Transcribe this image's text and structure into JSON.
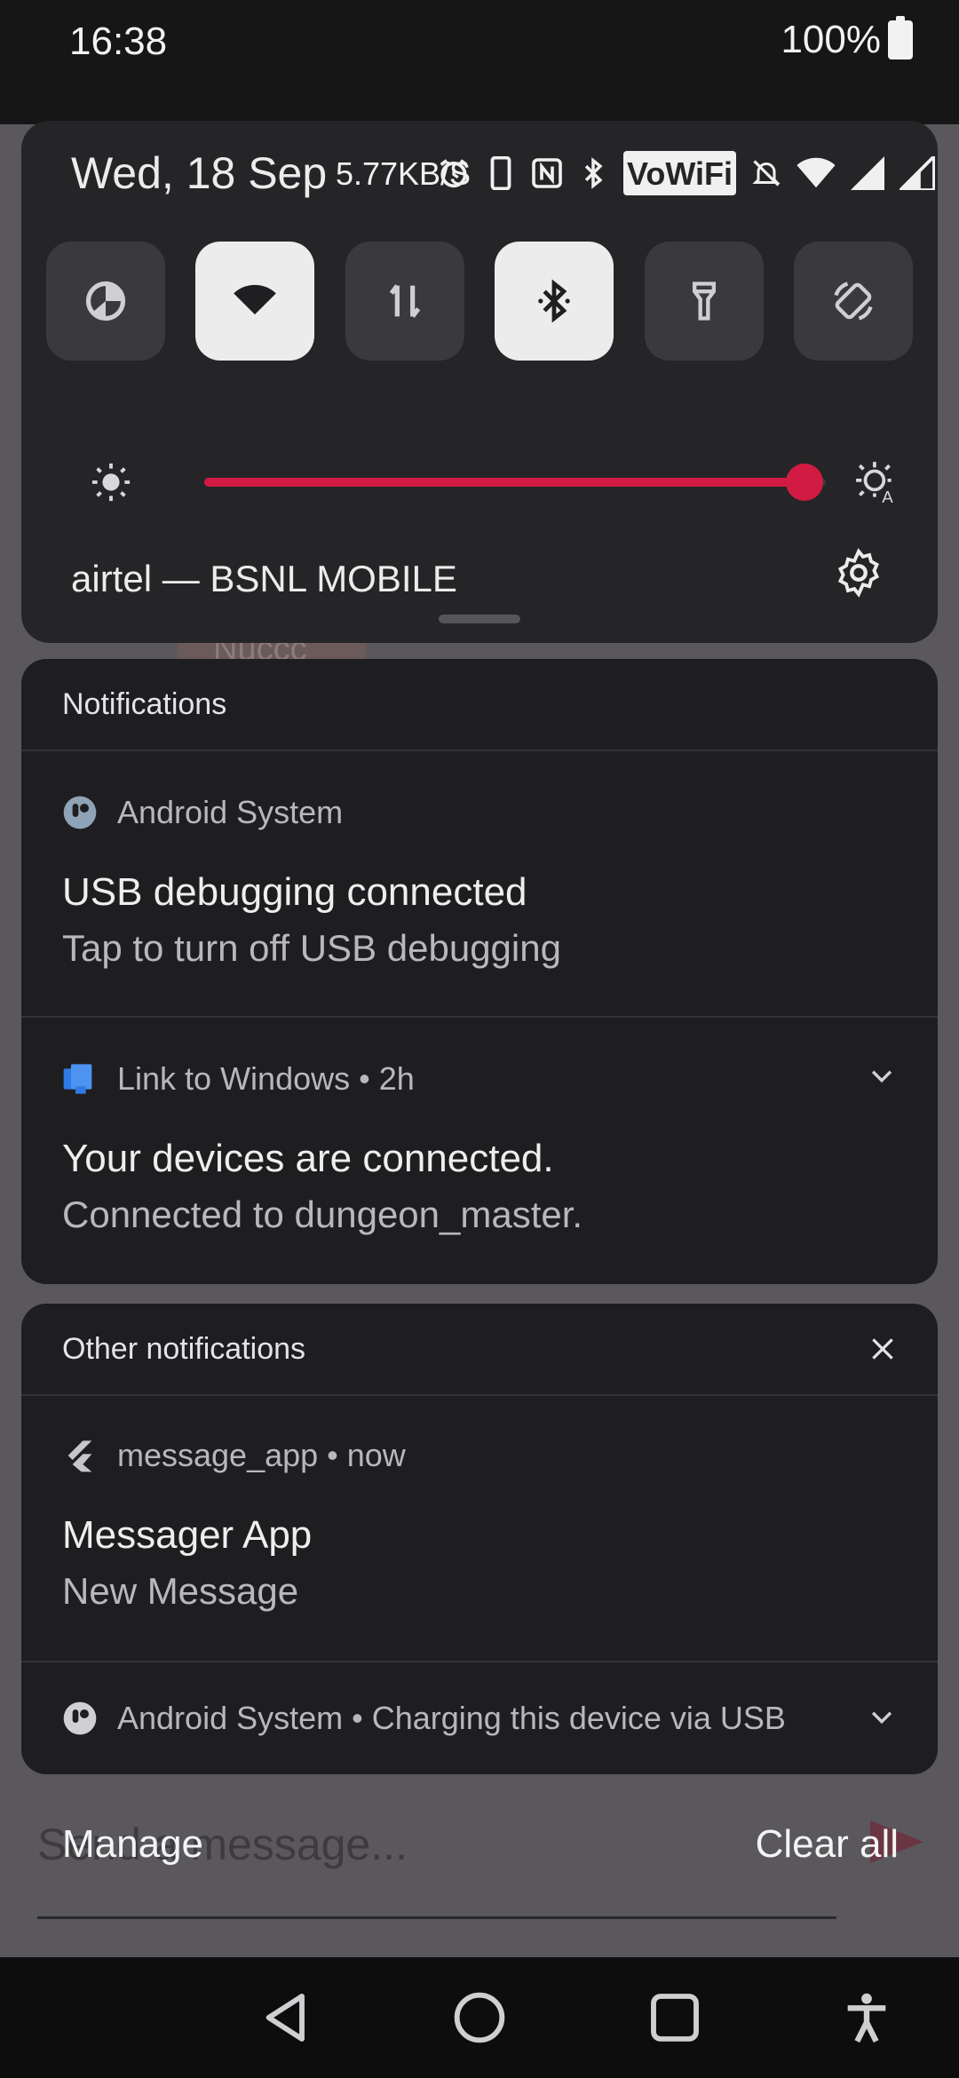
{
  "status_bar": {
    "time": "16:38",
    "battery": "100%"
  },
  "quick_settings": {
    "date": "Wed, 18 Sep",
    "net_speed": {
      "value": "5.77",
      "unit": "KB/S"
    },
    "vowifi_badge": "VoWiFi",
    "tiles": [
      {
        "name": "data-saver",
        "active": false
      },
      {
        "name": "wifi",
        "active": true
      },
      {
        "name": "mobile-data",
        "active": false
      },
      {
        "name": "bluetooth",
        "active": true
      },
      {
        "name": "flashlight",
        "active": false
      },
      {
        "name": "auto-rotate",
        "active": false
      }
    ],
    "brightness_level": 0.965,
    "brightness_color": "#d11b42",
    "carrier": "airtel — BSNL MOBILE"
  },
  "notifications_card": {
    "header": "Notifications",
    "items": [
      {
        "app": "Android System",
        "title": "USB debugging connected",
        "text": "Tap to turn off USB debugging"
      },
      {
        "app": "Link to Windows • 2h",
        "title": "Your devices are connected.",
        "text": "Connected to dungeon_master."
      }
    ]
  },
  "other_card": {
    "header": "Other notifications",
    "items": [
      {
        "app": "message_app • now",
        "title": "Messager App",
        "text": "New Message"
      },
      {
        "app": "Android System • Charging this device via USB"
      }
    ]
  },
  "footer": {
    "manage": "Manage",
    "clear_all": "Clear all"
  },
  "background_app": {
    "chip_text": "Nuccc",
    "compose_placeholder": "Send a message..."
  }
}
